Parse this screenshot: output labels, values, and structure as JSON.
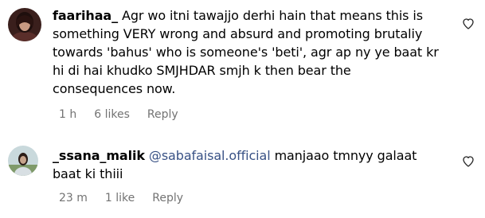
{
  "comments": [
    {
      "username": "faarihaa_",
      "text": " Agr wo itni tawajjo derhi hain that means this is something VERY wrong and absurd and promoting brutaliy towards 'bahus' who is someone's 'beti', agr ap ny ye baat kr hi di hai khudko SMJHDAR smjh k then bear the consequences now.",
      "time": "1 h",
      "likes": "6 likes",
      "reply": "Reply"
    },
    {
      "username": "_ssana_malik",
      "mention": "@sabafaisal.official",
      "text": " manjaao tmnyy galaat baat ki thiii",
      "time": "23 m",
      "likes": "1 like",
      "reply": "Reply"
    }
  ],
  "icons": {
    "like": "heart-outline-icon"
  },
  "colors": {
    "text": "#000000",
    "meta": "#737373",
    "mention": "#385185"
  }
}
